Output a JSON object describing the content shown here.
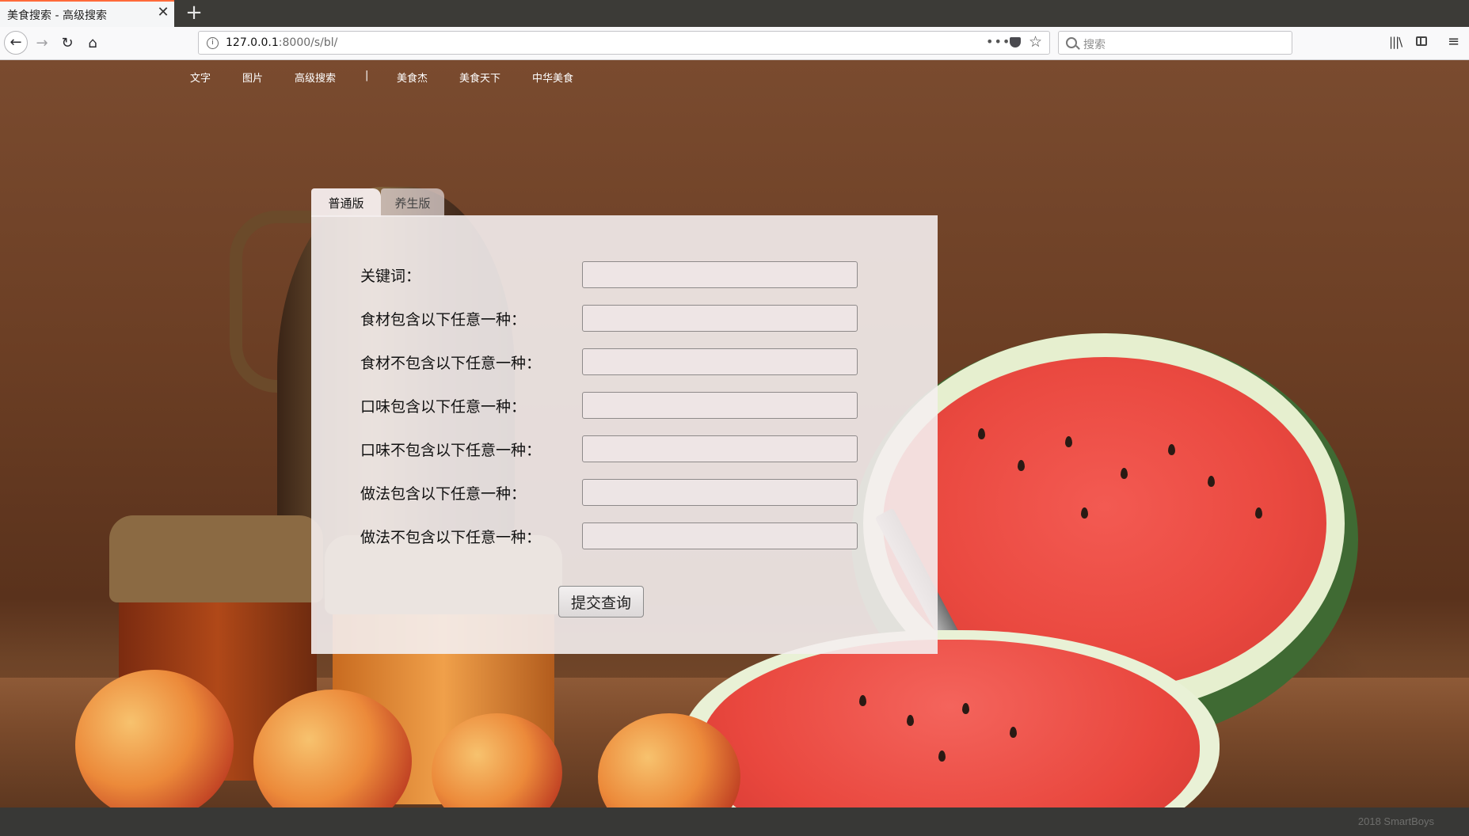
{
  "browser": {
    "tab_title": "美食搜索 - 高级搜索",
    "close_glyph": "✕",
    "new_tab_glyph": "+",
    "url_host": "127.0.0.1",
    "url_path": ":8000/s/bl/",
    "url_more": "•••",
    "search_placeholder": "搜索",
    "accent_color": "#ff6a3a"
  },
  "topnav": {
    "items": [
      "文字",
      "图片",
      "高级搜索",
      "|",
      "美食杰",
      "美食天下",
      "中华美食"
    ]
  },
  "form": {
    "tabs": [
      "普通版",
      "养生版"
    ],
    "active_tab": "普通版",
    "fields": [
      {
        "label": "关键词：",
        "value": ""
      },
      {
        "label": "食材包含以下任意一种：",
        "value": ""
      },
      {
        "label": "食材不包含以下任意一种：",
        "value": ""
      },
      {
        "label": "口味包含以下任意一种：",
        "value": ""
      },
      {
        "label": "口味不包含以下任意一种：",
        "value": ""
      },
      {
        "label": "做法包含以下任意一种：",
        "value": ""
      },
      {
        "label": "做法不包含以下任意一种：",
        "value": ""
      }
    ],
    "submit_label": "提交查询"
  },
  "footer": {
    "text": "2018 SmartBoys"
  },
  "icons": [
    "back-arrow-icon",
    "forward-arrow-icon",
    "reload-icon",
    "home-icon",
    "info-icon",
    "page-actions-icon",
    "pocket-icon",
    "bookmark-star-icon",
    "search-icon",
    "library-icon",
    "sidebar-icon",
    "hamburger-menu-icon"
  ]
}
